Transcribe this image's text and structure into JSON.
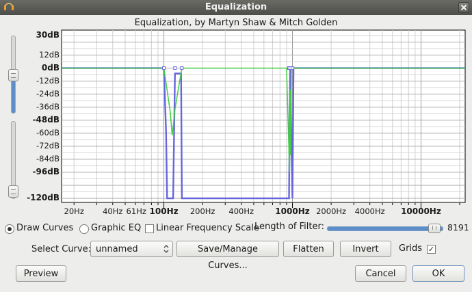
{
  "window": {
    "title": "Equalization"
  },
  "plot": {
    "subtitle": "Equalization, by Martyn Shaw & Mitch Golden",
    "y_labels": [
      {
        "text": "30dB",
        "db": 30,
        "bold": true
      },
      {
        "text": "12dB",
        "db": 12,
        "bold": false
      },
      {
        "text": "0dB",
        "db": 0,
        "bold": true
      },
      {
        "text": "-12dB",
        "db": -12,
        "bold": false
      },
      {
        "text": "-24dB",
        "db": -24,
        "bold": false
      },
      {
        "text": "-36dB",
        "db": -36,
        "bold": false
      },
      {
        "text": "-48dB",
        "db": -48,
        "bold": true
      },
      {
        "text": "-60dB",
        "db": -60,
        "bold": false
      },
      {
        "text": "-72dB",
        "db": -72,
        "bold": false
      },
      {
        "text": "-84dB",
        "db": -84,
        "bold": false
      },
      {
        "text": "-96dB",
        "db": -96,
        "bold": true
      },
      {
        "text": "-120dB",
        "db": -120,
        "bold": true
      }
    ],
    "x_labels": [
      {
        "text": "20Hz",
        "hz": 20,
        "bold": false
      },
      {
        "text": "40Hz",
        "hz": 40,
        "bold": false
      },
      {
        "text": "61Hz",
        "hz": 61,
        "bold": false
      },
      {
        "text": "100Hz",
        "hz": 100,
        "bold": true
      },
      {
        "text": "200Hz",
        "hz": 200,
        "bold": false
      },
      {
        "text": "400Hz",
        "hz": 400,
        "bold": false
      },
      {
        "text": "1000Hz",
        "hz": 1000,
        "bold": true
      },
      {
        "text": "2000Hz",
        "hz": 2000,
        "bold": false
      },
      {
        "text": "4000Hz",
        "hz": 4000,
        "bold": false
      },
      {
        "text": "10000Hz",
        "hz": 10000,
        "bold": true
      }
    ]
  },
  "chart_data": {
    "type": "line",
    "title": "Equalization, by Martyn Shaw & Mitch Golden",
    "xlabel": "",
    "ylabel": "",
    "x_scale": "log",
    "xlim": [
      16,
      22050
    ],
    "ylim": [
      -120,
      30
    ],
    "grid": true,
    "series": [
      {
        "color": "#6666dd",
        "x": [
          16,
          100,
          104,
          106,
          118,
          120,
          122,
          136,
          138,
          940,
          950,
          960,
          1000,
          1020,
          22050
        ],
        "y": [
          0,
          0,
          -60,
          -120,
          -120,
          -60,
          -5,
          -5,
          -120,
          -120,
          -60,
          0,
          -120,
          0,
          0
        ]
      },
      {
        "color": "#44cc44",
        "x": [
          16,
          100,
          112,
          116,
          122,
          130,
          138,
          900,
          950,
          960,
          970,
          980,
          22050
        ],
        "y": [
          0,
          0,
          -40,
          -62,
          -38,
          -18,
          0,
          0,
          -96,
          -20,
          -80,
          0,
          0
        ]
      }
    ]
  },
  "controls": {
    "draw_curves": "Draw Curves",
    "graphic_eq": "Graphic EQ",
    "linear_scale": "Linear Frequency Scale",
    "length_label": "Length of Filter:",
    "length_value": "8191",
    "length_fraction": 0.98,
    "select_curve_label": "Select Curve:",
    "select_curve_value": "unnamed",
    "save_manage": "Save/Manage Curves...",
    "flatten": "Flatten",
    "invert": "Invert",
    "grids_label": "Grids",
    "grids_checked": "✓",
    "draw_selected": true,
    "linear_checked": false
  },
  "buttons": {
    "preview": "Preview",
    "cancel": "Cancel",
    "ok": "OK"
  },
  "colors": {
    "accent": "#5d8ec8",
    "curve": "#6666dd",
    "curve2": "#44cc44"
  }
}
